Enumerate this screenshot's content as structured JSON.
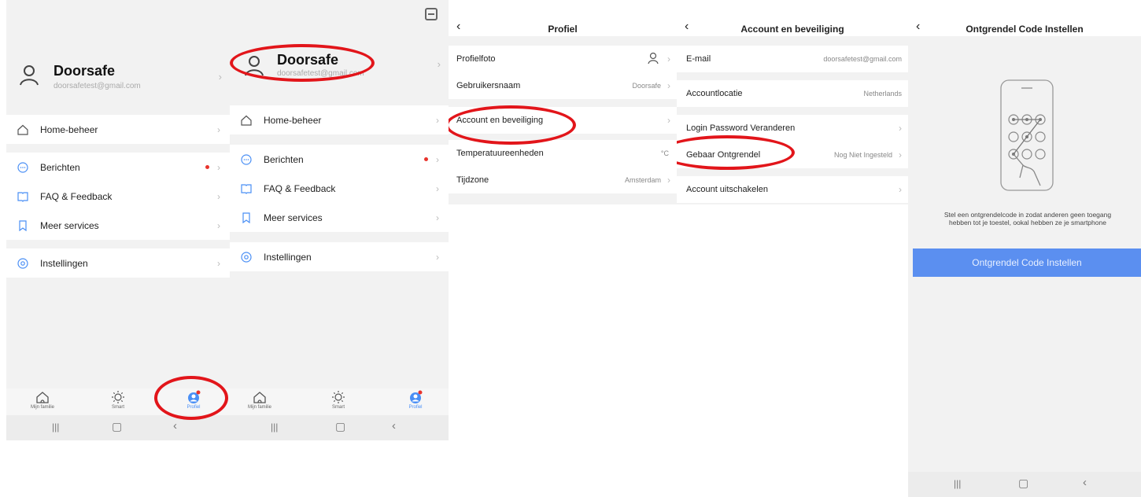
{
  "screen1": {
    "name": "Doorsafe",
    "email": "doorsafetest@gmail.com",
    "menu_group1": [
      {
        "label": "Home-beheer",
        "icon": "home-icon"
      }
    ],
    "menu_group2": [
      {
        "label": "Berichten",
        "icon": "message-icon",
        "dot": true
      },
      {
        "label": "FAQ & Feedback",
        "icon": "book-icon"
      },
      {
        "label": "Meer services",
        "icon": "bookmark-icon"
      }
    ],
    "menu_group3": [
      {
        "label": "Instellingen",
        "icon": "settings-icon"
      }
    ],
    "tabs": [
      {
        "label": "Mijn familie",
        "icon": "house-icon"
      },
      {
        "label": "Smart",
        "icon": "sun-icon"
      },
      {
        "label": "Profiel",
        "icon": "profile-icon",
        "active": true
      }
    ]
  },
  "screen2": {
    "name": "Doorsafe",
    "email": "doorsafetest@gmail.com",
    "tabs": [
      {
        "label": "Mijn familie"
      },
      {
        "label": "Smart"
      },
      {
        "label": "Profiel"
      }
    ]
  },
  "screen3": {
    "title": "Profiel",
    "rows": [
      {
        "label": "Profielfoto",
        "value": ""
      },
      {
        "label": "Gebruikersnaam",
        "value": "Doorsafe"
      },
      {
        "label": "Account en beveiliging",
        "value": ""
      },
      {
        "label": "Temperatuureenheden",
        "value": "°C"
      },
      {
        "label": "Tijdzone",
        "value": "Amsterdam"
      }
    ]
  },
  "screen4": {
    "title": "Account en beveiliging",
    "rows": [
      {
        "label": "E-mail",
        "value": "doorsafetest@gmail.com"
      },
      {
        "label": "Accountlocatie",
        "value": "Netherlands"
      },
      {
        "label": "Login Password Veranderen",
        "value": ""
      },
      {
        "label": "Gebaar Ontgrendel",
        "value": "Nog Niet Ingesteld"
      },
      {
        "label": "Account uitschakelen",
        "value": ""
      }
    ]
  },
  "screen5": {
    "title": "Ontgrendel Code Instellen",
    "hint_line1": "Stel een ontgrendelcode in zodat anderen geen toegang",
    "hint_line2": "hebben tot je toestel, ookal hebben ze je smartphone",
    "button": "Ontgrendel Code Instellen"
  },
  "colors": {
    "accent": "#4a8ff5",
    "highlight": "#e2151a",
    "cta": "#5b8ff0",
    "badge": "#e8332c"
  }
}
